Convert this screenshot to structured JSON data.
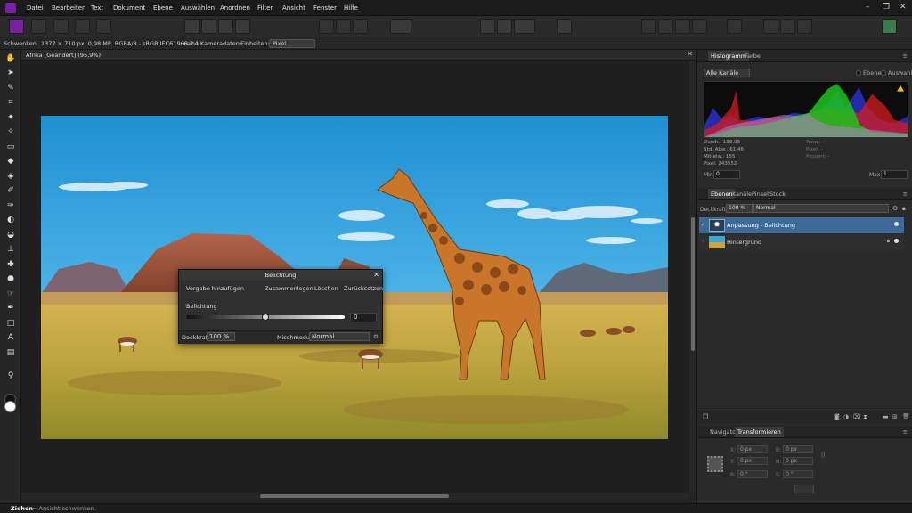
{
  "menu": [
    "Datei",
    "Bearbeiten",
    "Text",
    "Dokument",
    "Ebene",
    "Auswählen",
    "Anordnen",
    "Filter",
    "Ansicht",
    "Fenster",
    "Hilfe"
  ],
  "context": {
    "tool": "Schwenken",
    "info": "1377 × 710 px, 0,98 MP, RGBA/8 - sRGB IEC61966-2.1",
    "camera": "Keine Kameradaten",
    "units_label": "Einheiten:",
    "units_value": "Pixel"
  },
  "document": {
    "tab": "Afrika [Geändert] (95,9%)"
  },
  "histogram": {
    "tabs": [
      "Histogramm",
      "Farbe"
    ],
    "channel": "Alle Kanäle",
    "opt_layer": "Ebene",
    "opt_selection": "Auswahl",
    "stats_left": [
      "Durch.: 138,03",
      "Std. Abw.: 61,46",
      "Mittelw.: 155",
      "Pixel: 243552"
    ],
    "stats_right": [
      "Tonw.: -",
      "Pixel: -",
      "Prozent: -"
    ],
    "min_label": "Min:",
    "min_value": "0",
    "max_label": "Max:",
    "max_value": "1"
  },
  "layers": {
    "tabs": [
      "Ebenen",
      "Kanäle",
      "Pinsel",
      "Stock"
    ],
    "opacity_label": "Deckkraft:",
    "opacity_value": "100 %",
    "blend": "Normal",
    "items": [
      {
        "name": "Anpassung - Belichtung"
      },
      {
        "name": "Hintergrund"
      }
    ]
  },
  "transform": {
    "tabs": [
      "Navigator",
      "Transformieren"
    ],
    "fields": [
      {
        "l": "X:",
        "v": "0 px"
      },
      {
        "l": "B:",
        "v": "0 px"
      },
      {
        "l": "Y:",
        "v": "0 px"
      },
      {
        "l": "H:",
        "v": "0 px"
      },
      {
        "l": "R:",
        "v": "0 °"
      },
      {
        "l": "S:",
        "v": "0 °"
      }
    ]
  },
  "dialog": {
    "title": "Belichtung",
    "preset": "Vorgabe hinzufügen",
    "merge": "Zusammenlegen",
    "delete": "Löschen",
    "reset": "Zurücksetzen",
    "slider_label": "Belichtung",
    "slider_value": "0",
    "slider_fraction": 0.5,
    "opacity_label": "Deckkraft:",
    "opacity_value": "100 %",
    "blend_label": "Mischmodus:",
    "blend_value": "Normal"
  },
  "status": {
    "bold": "Ziehen",
    "rest": " = Ansicht schwenken."
  },
  "colors": {
    "accent": "#3d6a96",
    "brand": "#7a1fa2",
    "sky": "#2a9dd8",
    "grass": "#c9a640"
  }
}
